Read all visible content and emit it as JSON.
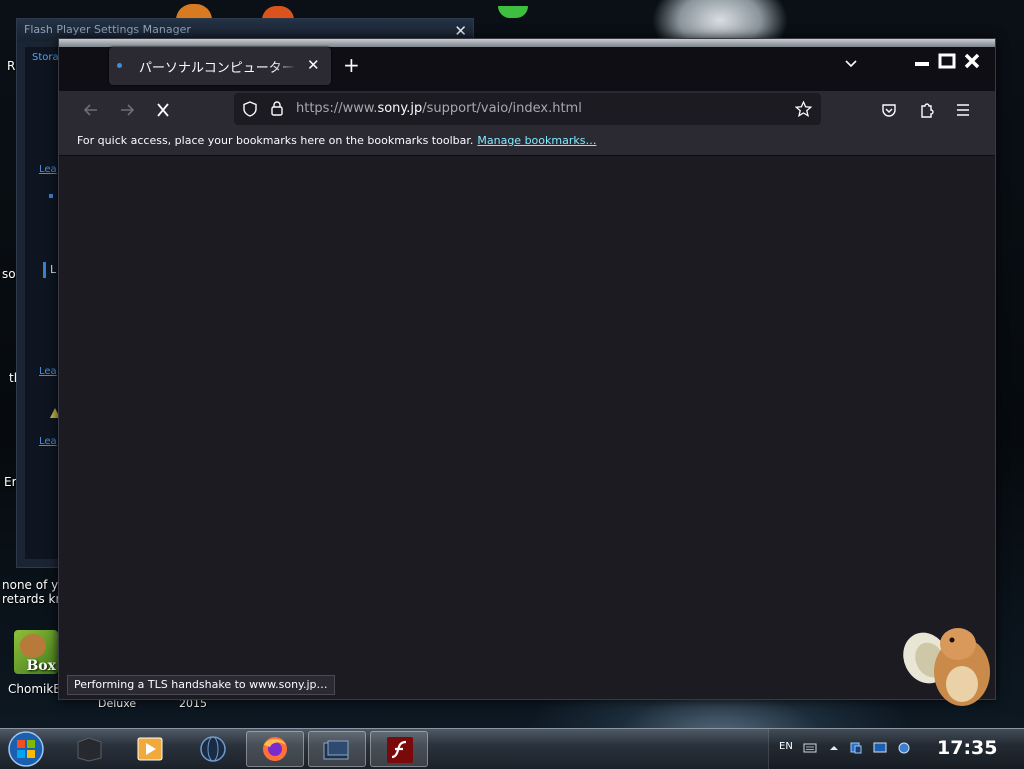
{
  "desktop": {
    "labels": {
      "r_label": "R",
      "so_label": "so",
      "tl_label": "tl",
      "er_label": "Er",
      "none_of_y": "none of y",
      "retards_kr": "retards kr",
      "chomik_label": "ChomikB",
      "box_text": "Box",
      "deluxe": "Deluxe",
      "year": "2015"
    }
  },
  "flash_window": {
    "title": "Flash Player Settings Manager",
    "tab_label": "Stora",
    "learn_link_1": "Lea",
    "learn_link_2": "Lea",
    "learn_link_3": "Lea",
    "list_item_label": "L"
  },
  "browser": {
    "tab": {
      "title": "パーソナルコンピューター VAIO",
      "close_label": "✕"
    },
    "new_tab_label": "+",
    "url": {
      "prefix": "https://www.",
      "host": "sony.jp",
      "path": "/support/vaio/index.html"
    },
    "bookmarks_bar": {
      "message": "For quick access, place your bookmarks here on the bookmarks toolbar.",
      "manage_link": "Manage bookmarks…"
    },
    "status_text": "Performing a TLS handshake to www.sony.jp…",
    "icons": {
      "back": "back-arrow-icon",
      "forward": "forward-arrow-icon",
      "stop": "stop-icon",
      "shield": "tracking-protection-shield-icon",
      "lock": "lock-icon",
      "bookmark_star": "star-icon",
      "pocket": "pocket-icon",
      "extensions": "puzzle-icon",
      "menu": "hamburger-menu-icon"
    }
  },
  "taskbar": {
    "language": "EN",
    "clock": "17:35",
    "apps": [
      "start-orb",
      "dark-cube-app",
      "media-player",
      "globe-app",
      "firefox",
      "window-switcher",
      "flash-player"
    ]
  },
  "colors": {
    "accent_link": "#80ebff",
    "browser_bg": "#1c1b22",
    "toolbar_bg": "#2b2a33",
    "flash_accent": "#4aa3ff"
  }
}
